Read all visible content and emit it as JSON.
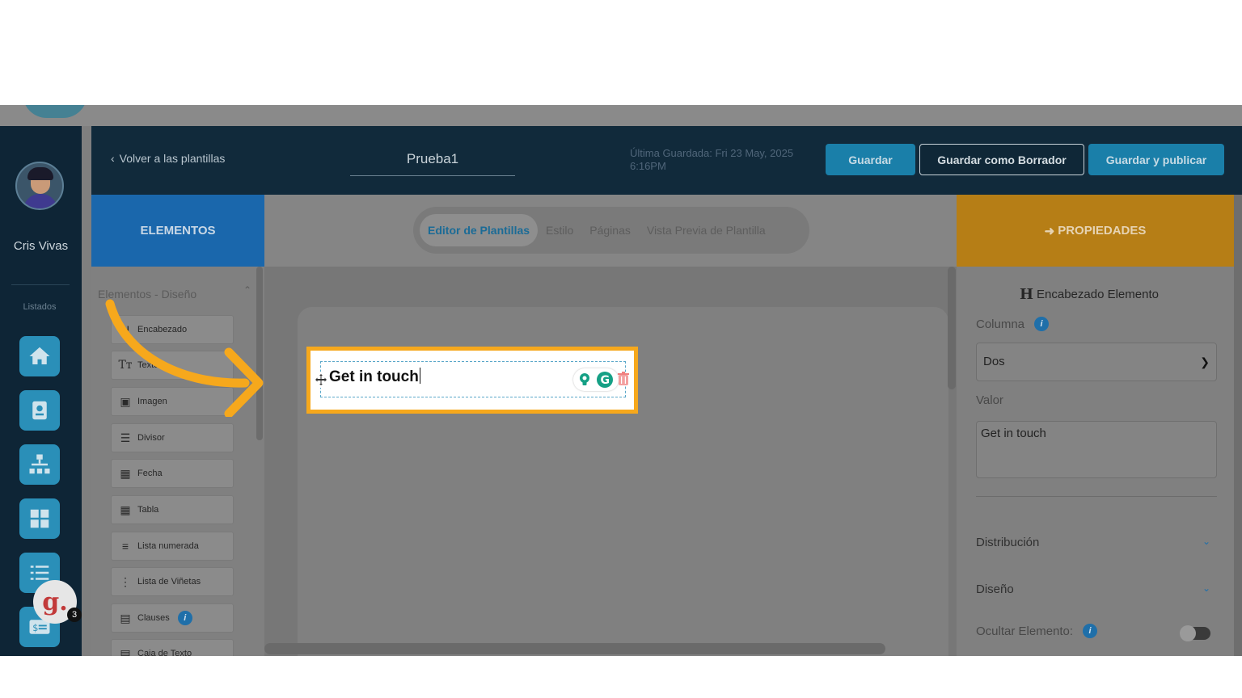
{
  "user": {
    "name": "Cris Vivas"
  },
  "rail": {
    "section_label": "Listados",
    "notification_count": "3",
    "grammarly_letter": "g."
  },
  "header": {
    "back_label": "Volver a las plantillas",
    "template_name": "Prueba1",
    "last_saved": "Última Guardada: Fri 23 May, 2025 6:16PM",
    "save_label": "Guardar",
    "draft_label": "Guardar como Borrador",
    "publish_label": "Guardar y publicar"
  },
  "elements": {
    "header_label": "ELEMENTOS",
    "section_title": "Elementos - Diseño",
    "items": [
      {
        "label": "Encabezado",
        "icon": "heading-icon"
      },
      {
        "label": "Texto",
        "icon": "text-icon"
      },
      {
        "label": "Imagen",
        "icon": "image-icon"
      },
      {
        "label": "Divisor",
        "icon": "divider-icon"
      },
      {
        "label": "Fecha",
        "icon": "calendar-icon"
      },
      {
        "label": "Tabla",
        "icon": "table-icon"
      },
      {
        "label": "Lista numerada",
        "icon": "numbered-list-icon"
      },
      {
        "label": "Lista de Viñetas",
        "icon": "bullet-list-icon"
      },
      {
        "label": "Clauses",
        "icon": "clauses-icon"
      },
      {
        "label": "Caja de Texto",
        "icon": "textbox-icon"
      }
    ]
  },
  "tabs": [
    {
      "label": "Editor de Plantillas",
      "active": true
    },
    {
      "label": "Estilo",
      "active": false
    },
    {
      "label": "Páginas",
      "active": false
    },
    {
      "label": "Vista Previa de Plantilla",
      "active": false
    }
  ],
  "canvas": {
    "heading_text": "Get in touch",
    "highlight_color": "#f6a81c"
  },
  "properties": {
    "header_label": "PROPIEDADES",
    "element_title": "Encabezado Elemento",
    "column_label": "Columna",
    "column_value": "Dos",
    "value_label": "Valor",
    "value_text": "Get in touch",
    "distribution_label": "Distribución",
    "design_label": "Diseño",
    "hide_label": "Ocultar Elemento:",
    "hide_enabled": false
  },
  "colors": {
    "accent": "#1a7fa9",
    "elements_header": "#1a67ac",
    "properties_header": "#b67e16",
    "annotation_arrow": "#f6a81c"
  }
}
